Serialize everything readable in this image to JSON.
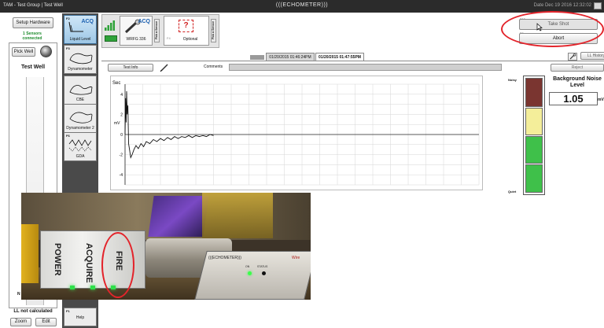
{
  "window": {
    "title": "TAM - Test Group | Test Well",
    "app_logo": "(((ECHOMETER)))",
    "datetime": "Date Dec 19 2016 12:32:02"
  },
  "left": {
    "setup_hardware": "Setup Hardware",
    "sensors_connected": "1 Sensors connected",
    "pick_well": "Pick Well",
    "well_name": "Test Well",
    "n_label": "N",
    "ll_status": "LL not calculated",
    "zoom": "Zoom",
    "edit": "Edit"
  },
  "modes": [
    {
      "key": "F2",
      "label": "Liquid Level",
      "active": true,
      "badge": "ACQ"
    },
    {
      "key": "F3",
      "label": "Dynamometer"
    },
    {
      "key": "",
      "label": "CBE"
    },
    {
      "key": "",
      "label": "Dynamometer 2"
    },
    {
      "key": "F6",
      "label": "GDA"
    },
    {
      "key": "F1",
      "label": "Help"
    }
  ],
  "sensors": {
    "primary": {
      "model": "WRFG 336",
      "badge": "ACQ",
      "side": "Pick a Sensor"
    },
    "optional": {
      "label": "Optional",
      "key": "F4",
      "symbol": "?",
      "side": "Pick a Sensor"
    }
  },
  "actions": {
    "take_shot_key": "F10",
    "take_shot": "Take Shot",
    "abort_key": "F9",
    "abort": "Abort"
  },
  "tabs": {
    "items": [
      "01/20/2015 01:46:24PM",
      "01/20/2015 01:47:55PM"
    ],
    "active_index": 1,
    "ll_history": "LL History"
  },
  "info": {
    "test_info": "Test Info",
    "comments_label": "Comments",
    "comments_value": "",
    "reject": "Reject"
  },
  "noise": {
    "title": "Background Noise Level",
    "value": "1.05",
    "unit": "mV",
    "noisy": "Noisy",
    "quiet": "Quiet",
    "colors": [
      "#7a3530",
      "#f4ee9a",
      "#3fc04a",
      "#3fc04a"
    ]
  },
  "photo": {
    "power": "POWER",
    "acquire": "ACQUIRE",
    "fire": "FIRE",
    "device_logo": "(((ECHOMETER)))",
    "device_brand": "Wire",
    "led1": "ON",
    "led2": "STATUS"
  },
  "chart_data": {
    "type": "line",
    "title": "",
    "xlabel": "",
    "ylabel": "mV",
    "x_unit_label": "Sec",
    "xlim": [
      0,
      20
    ],
    "ylim": [
      -5,
      5
    ],
    "yticks": [
      -4,
      -2,
      0,
      2,
      4
    ],
    "grid": true,
    "series": [
      {
        "color": "#111111",
        "x": [
          0,
          0.03,
          0.06,
          0.09,
          0.12,
          0.16,
          0.2,
          0.26,
          0.32,
          0.4,
          0.5,
          0.62,
          0.75,
          0.9,
          1.05,
          1.2,
          1.4,
          1.6,
          1.8,
          2.0,
          2.2,
          2.4,
          2.6,
          2.8,
          3.0,
          3.2,
          3.4,
          3.6,
          3.8,
          4.0,
          4.2,
          4.4,
          4.6,
          4.8,
          5.0
        ],
        "y": [
          0,
          3.6,
          1.2,
          4.3,
          2.0,
          2.9,
          -0.9,
          -1.6,
          -2.3,
          -2.0,
          -1.5,
          -1.1,
          -1.4,
          -0.9,
          -1.2,
          -0.7,
          -0.9,
          -0.5,
          -0.7,
          -0.4,
          -0.6,
          -0.3,
          -0.5,
          -0.2,
          -0.4,
          -0.2,
          -0.3,
          -0.1,
          -0.3,
          -0.1,
          -0.2,
          -0.1,
          -0.2,
          0.0,
          -0.1
        ]
      }
    ]
  }
}
